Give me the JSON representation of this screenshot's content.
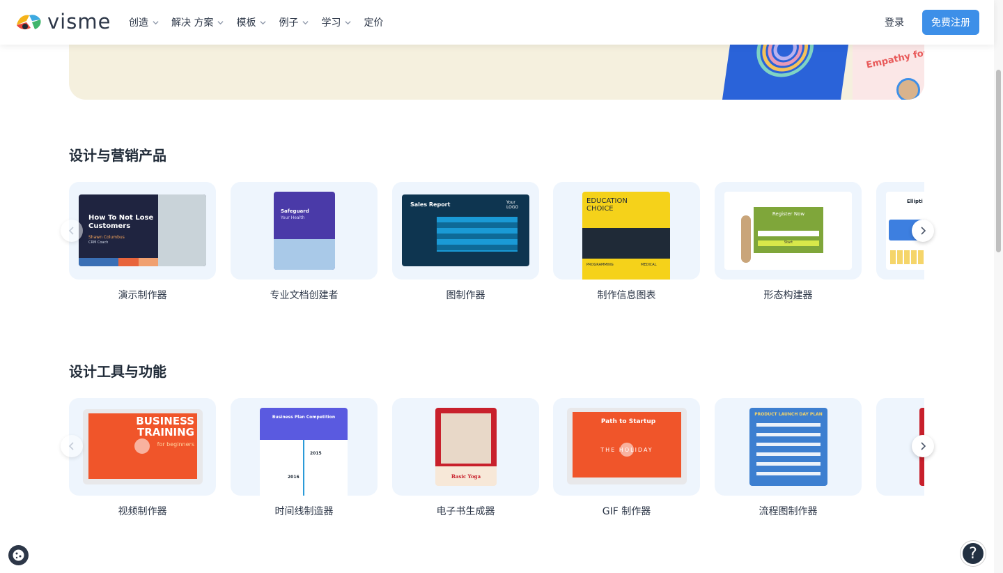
{
  "brand": {
    "name": "visme"
  },
  "nav": {
    "items": [
      {
        "label": "创造",
        "has_dropdown": true
      },
      {
        "label": "解决 方案",
        "has_dropdown": true
      },
      {
        "label": "模板",
        "has_dropdown": true
      },
      {
        "label": "例子",
        "has_dropdown": true
      },
      {
        "label": "学习",
        "has_dropdown": true
      },
      {
        "label": "定价",
        "has_dropdown": false
      }
    ],
    "login": "登录",
    "signup": "免费注册"
  },
  "hero": {
    "card_text": "Empathy for Ev Fundrais"
  },
  "sections": [
    {
      "title": "设计与营销产品",
      "cards": [
        {
          "label": "演示制作器",
          "thumb_text": "How To Not Lose Customers",
          "thumb_sub": "Shawn Columbus",
          "thumb_sub2": "CRM Coach"
        },
        {
          "label": "专业文档创建者",
          "thumb_text": "Safeguard",
          "thumb_sub": "Your Health"
        },
        {
          "label": "图制作器",
          "thumb_text": "Sales Report",
          "thumb_sub": "Your LOGO"
        },
        {
          "label": "制作信息图表",
          "thumb_text": "EDUCATION CHOICE",
          "thumb_sub": "PROGRAMMING",
          "thumb_sub2": "MEDICAL"
        },
        {
          "label": "形态构建器",
          "thumb_text": "Register Now",
          "thumb_sub": "Start"
        },
        {
          "label": "",
          "thumb_text": "Ellipti"
        }
      ]
    },
    {
      "title": "设计工具与功能",
      "cards": [
        {
          "label": "视频制作器",
          "thumb_text": "BUSINESS TRAINING",
          "thumb_sub": "for beginners"
        },
        {
          "label": "时间线制造器",
          "thumb_text": "Business Plan Competition",
          "thumb_sub": "2015",
          "thumb_sub2": "2016"
        },
        {
          "label": "电子书生成器",
          "thumb_text": "Basic Yoga"
        },
        {
          "label": "GIF 制作器",
          "thumb_text": "Path to Startup",
          "thumb_sub": "THE HOLIDAY"
        },
        {
          "label": "流程图制作器",
          "thumb_text": "PRODUCT LAUNCH DAY PLAN"
        },
        {
          "label": ""
        }
      ]
    }
  ],
  "help_label": "?",
  "colors": {
    "accent": "#3d8fe8",
    "card_bg": "#eef5fd",
    "hero_bg": "#f5f0de"
  }
}
